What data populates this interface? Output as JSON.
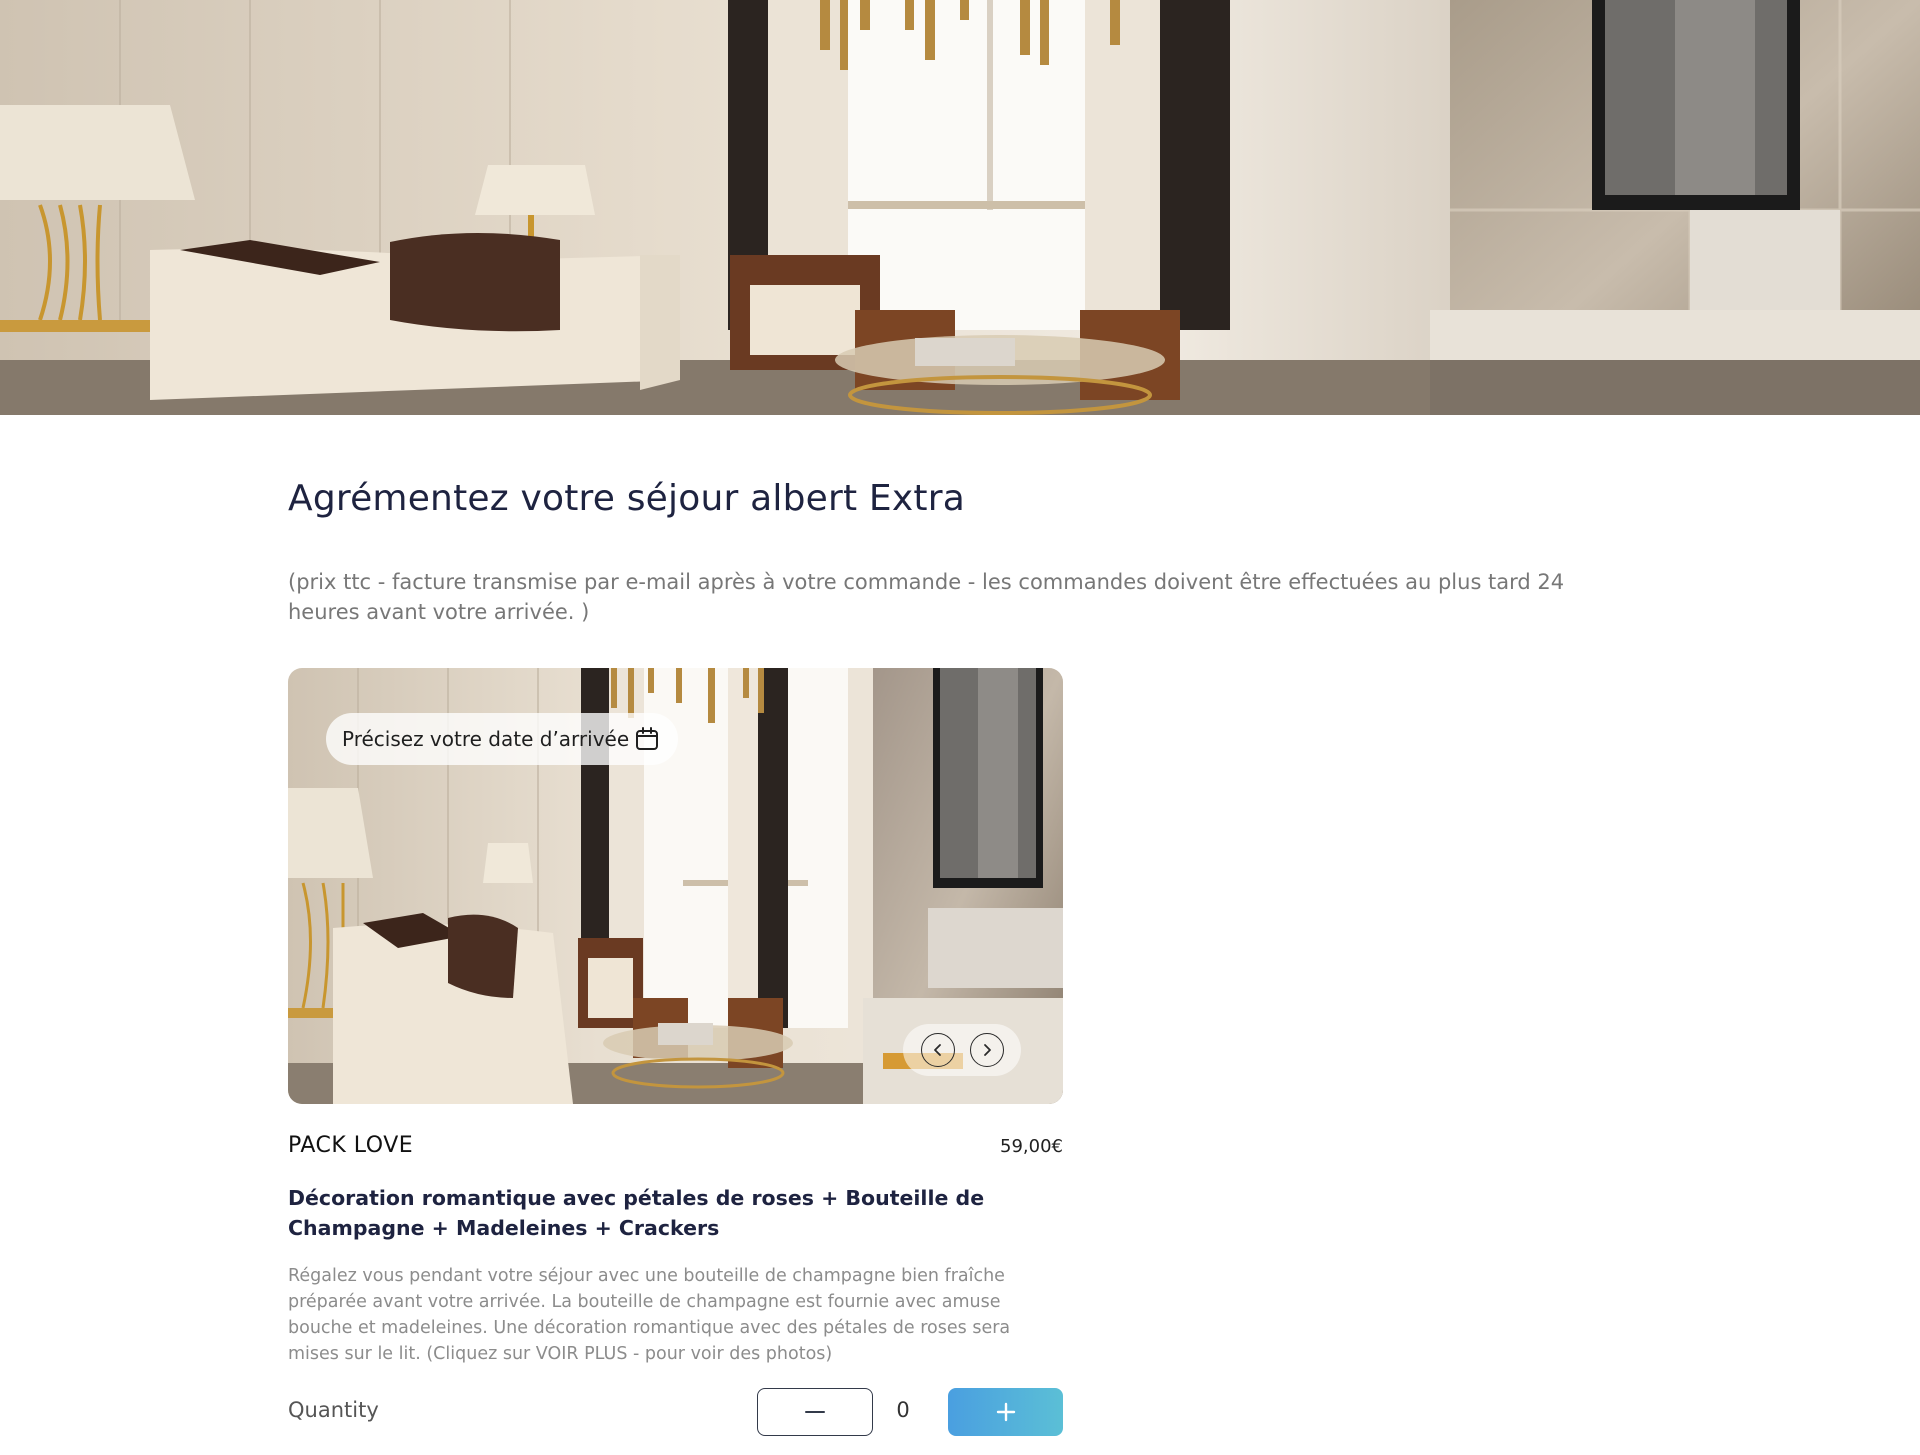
{
  "page": {
    "title": "Agrémentez votre séjour albert Extra",
    "subtitle": "(prix ttc - facture transmise par e-mail après à votre commande - les commandes doivent être effectuées au plus tard 24 heures avant votre arrivée. )"
  },
  "hero": {
    "image": "luxury-living-room-photo"
  },
  "product": {
    "image": "luxury-living-room-photo",
    "date_picker_label": "Précisez votre date d’arrivée",
    "name": "PACK LOVE",
    "price": "59,00€",
    "headline": "Décoration romantique avec pétales de roses + Bouteille de Champagne + Madeleines + Crackers",
    "description": "Régalez vous pendant votre séjour avec une bouteille de champagne bien fraîche préparée avant votre arrivée. La bouteille de champagne est fournie avec amuse bouche et madeleines. Une décoration romantique avec des pétales de roses sera mises sur le lit. (Cliquez sur VOIR PLUS - pour voir des photos)",
    "quantity_label": "Quantity",
    "quantity_value": "0"
  },
  "icons": {
    "calendar": "calendar-icon",
    "prev": "chevron-left-icon",
    "next": "chevron-right-icon",
    "minus": "minus-icon",
    "plus": "plus-icon"
  },
  "colors": {
    "title": "#1e2340",
    "subtitle": "#777777",
    "plus_button_start": "#4a9fe0",
    "plus_button_end": "#5bbfd6"
  }
}
